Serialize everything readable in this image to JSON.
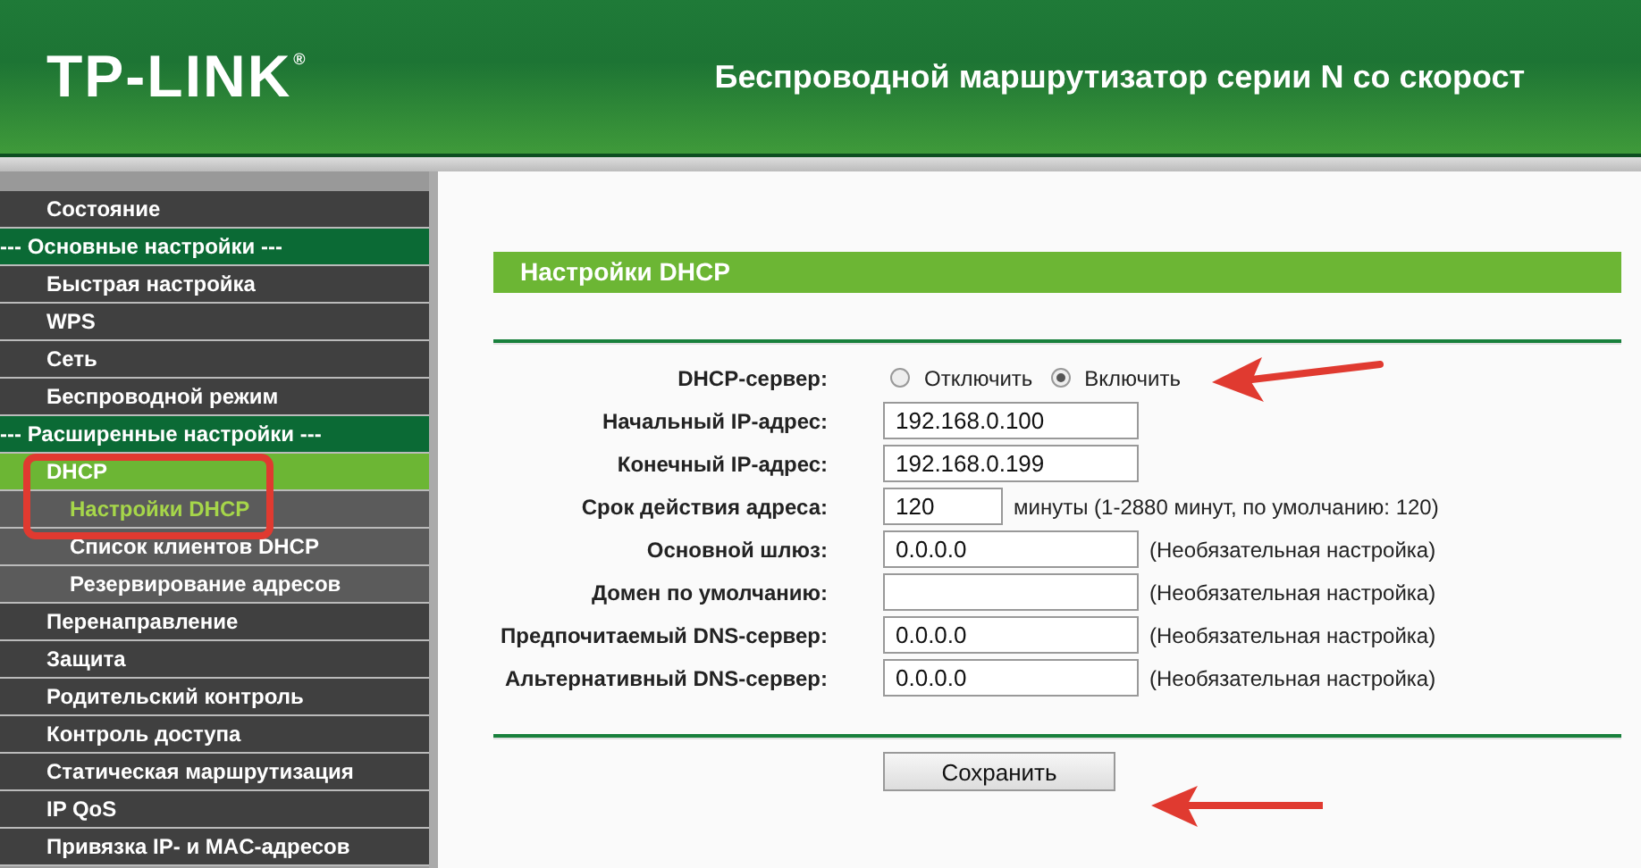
{
  "header": {
    "logo": "TP-LINK",
    "logo_mark": "®",
    "title": "Беспроводной маршрутизатор серии N со скорост"
  },
  "sidebar": {
    "items": [
      {
        "label": "Состояние",
        "kind": "item",
        "selected": false
      },
      {
        "label": "--- Основные настройки ---",
        "kind": "section",
        "selected": false
      },
      {
        "label": "Быстрая настройка",
        "kind": "item",
        "selected": false
      },
      {
        "label": "WPS",
        "kind": "item",
        "selected": false
      },
      {
        "label": "Сеть",
        "kind": "item",
        "selected": false
      },
      {
        "label": "Беспроводной режим",
        "kind": "item",
        "selected": false
      },
      {
        "label": "--- Расширенные настройки ---",
        "kind": "section",
        "selected": false
      },
      {
        "label": "DHCP",
        "kind": "item",
        "selected": true
      },
      {
        "label": "Настройки DHCP",
        "kind": "sub",
        "selected": true
      },
      {
        "label": "Список клиентов DHCP",
        "kind": "sub",
        "selected": false
      },
      {
        "label": "Резервирование адресов",
        "kind": "sub",
        "selected": false
      },
      {
        "label": "Перенаправление",
        "kind": "item",
        "selected": false
      },
      {
        "label": "Защита",
        "kind": "item",
        "selected": false
      },
      {
        "label": "Родительский контроль",
        "kind": "item",
        "selected": false
      },
      {
        "label": "Контроль доступа",
        "kind": "item",
        "selected": false
      },
      {
        "label": "Статическая маршрутизация",
        "kind": "item",
        "selected": false
      },
      {
        "label": "IP QoS",
        "kind": "item",
        "selected": false
      },
      {
        "label": "Привязка IP- и MAC-адресов",
        "kind": "item",
        "selected": false
      }
    ]
  },
  "panel": {
    "title": "Настройки DHCP",
    "fields": [
      {
        "kind": "radio",
        "label": "DHCP-сервер:",
        "options": [
          {
            "label": "Отключить",
            "selected": false
          },
          {
            "label": "Включить",
            "selected": true
          }
        ]
      },
      {
        "kind": "input",
        "label": "Начальный IP-адрес:",
        "value": "192.168.0.100"
      },
      {
        "kind": "input",
        "label": "Конечный IP-адрес:",
        "value": "192.168.0.199"
      },
      {
        "kind": "short",
        "label": "Срок действия адреса:",
        "value": "120",
        "note": "минуты (1-2880 минут, по умолчанию: 120)"
      },
      {
        "kind": "input",
        "label": "Основной шлюз:",
        "value": "0.0.0.0",
        "note": "(Необязательная настройка)"
      },
      {
        "kind": "input",
        "label": "Домен по умолчанию:",
        "note": "(Необязательная настройка)"
      },
      {
        "kind": "input",
        "label": "Предпочитаемый DNS-сервер:",
        "value": "0.0.0.0",
        "note": "(Необязательная настройка)"
      },
      {
        "kind": "input",
        "label": "Альтернативный DNS-сервер:",
        "value": "0.0.0.0",
        "note": "(Необязательная настройка)"
      }
    ],
    "save_button": "Сохранить"
  }
}
